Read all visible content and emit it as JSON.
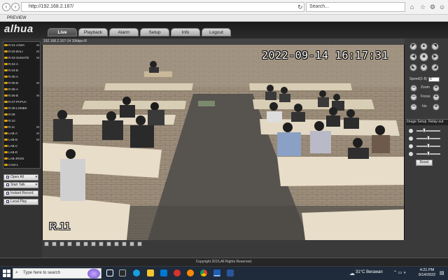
{
  "browser": {
    "url": "http://192.168.2.167/",
    "search_placeholder": "Search...",
    "tab_title": "PREVIEW"
  },
  "app": {
    "logo": "alhua",
    "tabs": [
      "Live",
      "Playback",
      "Alarm",
      "Setup",
      "Info",
      "Logout"
    ],
    "active_tab": "Live"
  },
  "cameras": [
    {
      "label": "R.01-JAWA",
      "flag": "M"
    },
    {
      "label": "R.02-BALI",
      "flag": "M"
    },
    {
      "label": "R.03-SUMATE",
      "flag": "M"
    },
    {
      "label": "R.04-A",
      "flag": ""
    },
    {
      "label": "R.04-B",
      "flag": ""
    },
    {
      "label": "R.05-A",
      "flag": ""
    },
    {
      "label": "R.05-B",
      "flag": "M"
    },
    {
      "label": "R.06-A",
      "flag": ""
    },
    {
      "label": "R.06-B",
      "flag": "M"
    },
    {
      "label": "R.07-PAPUA",
      "flag": ""
    },
    {
      "label": "R.08-LOMBK",
      "flag": ""
    },
    {
      "label": "R.09",
      "flag": ""
    },
    {
      "label": "R.10",
      "flag": ""
    },
    {
      "label": "R.11",
      "flag": "M"
    },
    {
      "label": "LAB-A",
      "flag": "M"
    },
    {
      "label": "LAB-B",
      "flag": "M"
    },
    {
      "label": "LAB-C",
      "flag": ""
    },
    {
      "label": "LAB-D",
      "flag": ""
    },
    {
      "label": "LAB-JRGN",
      "flag": ""
    },
    {
      "label": "CAM-1",
      "flag": ""
    }
  ],
  "side_buttons": {
    "open_all": "Open All",
    "start_talk": "Start Talk",
    "instant_record": "Instant Record",
    "local_play": "Local Play"
  },
  "video": {
    "info_bar": "192.168.2.167-14 10kbps-R",
    "timestamp": "2022-09-14 16:17:31",
    "room_label": "R.11"
  },
  "ptz": {
    "speed_label": "Speed(1-8)",
    "speed_value": "5",
    "zoom_label": "Zoom",
    "focus_label": "Focus",
    "iris_label": "Iris"
  },
  "image_setup": {
    "title": "Image Setup",
    "relay_out": "Relay-out",
    "reset_label": "Reset",
    "slider_levels": [
      0.3,
      0.5,
      0.5,
      0.5
    ]
  },
  "footer": {
    "copyright": "Copyright 2015,All Rights Reserved."
  },
  "taskbar": {
    "search_placeholder": "Type here to search",
    "weather": "31°C  Berawan",
    "time": "4:21 PM",
    "date": "9/14/2022"
  }
}
